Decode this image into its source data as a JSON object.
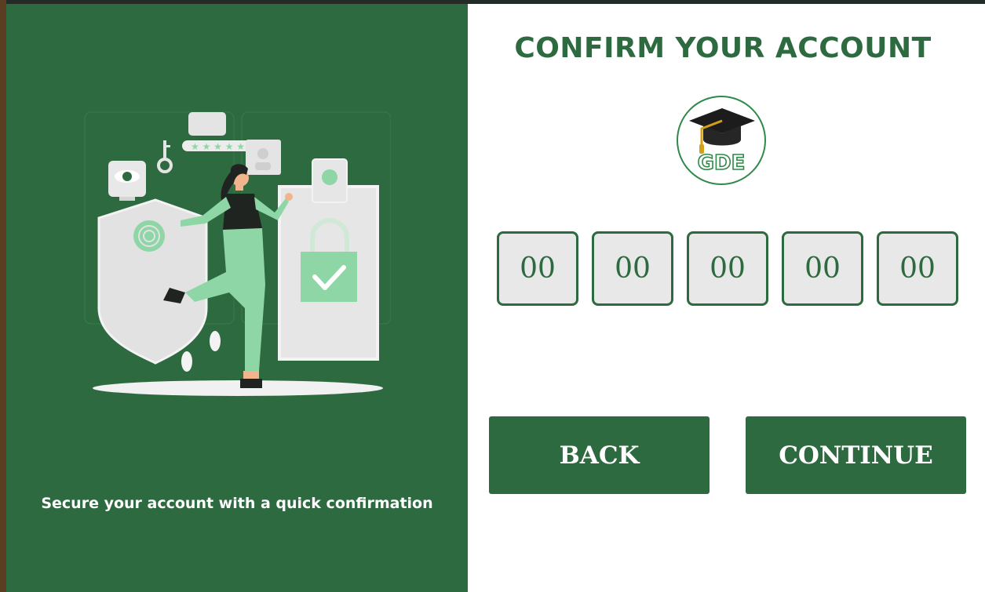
{
  "illustration": {
    "caption": "Secure your account with a quick confirmation",
    "icon": "security-illustration"
  },
  "confirm": {
    "title": "CONFIRM YOUR ACCOUNT",
    "logo_text": "GDE",
    "code_digits": [
      "00",
      "00",
      "00",
      "00",
      "00"
    ]
  },
  "buttons": {
    "back": "BACK",
    "continue": "CONTINUE"
  },
  "colors": {
    "primary_green": "#2e6a40",
    "light_green": "#8ed6a6",
    "box_fill": "#e8e8e8"
  }
}
